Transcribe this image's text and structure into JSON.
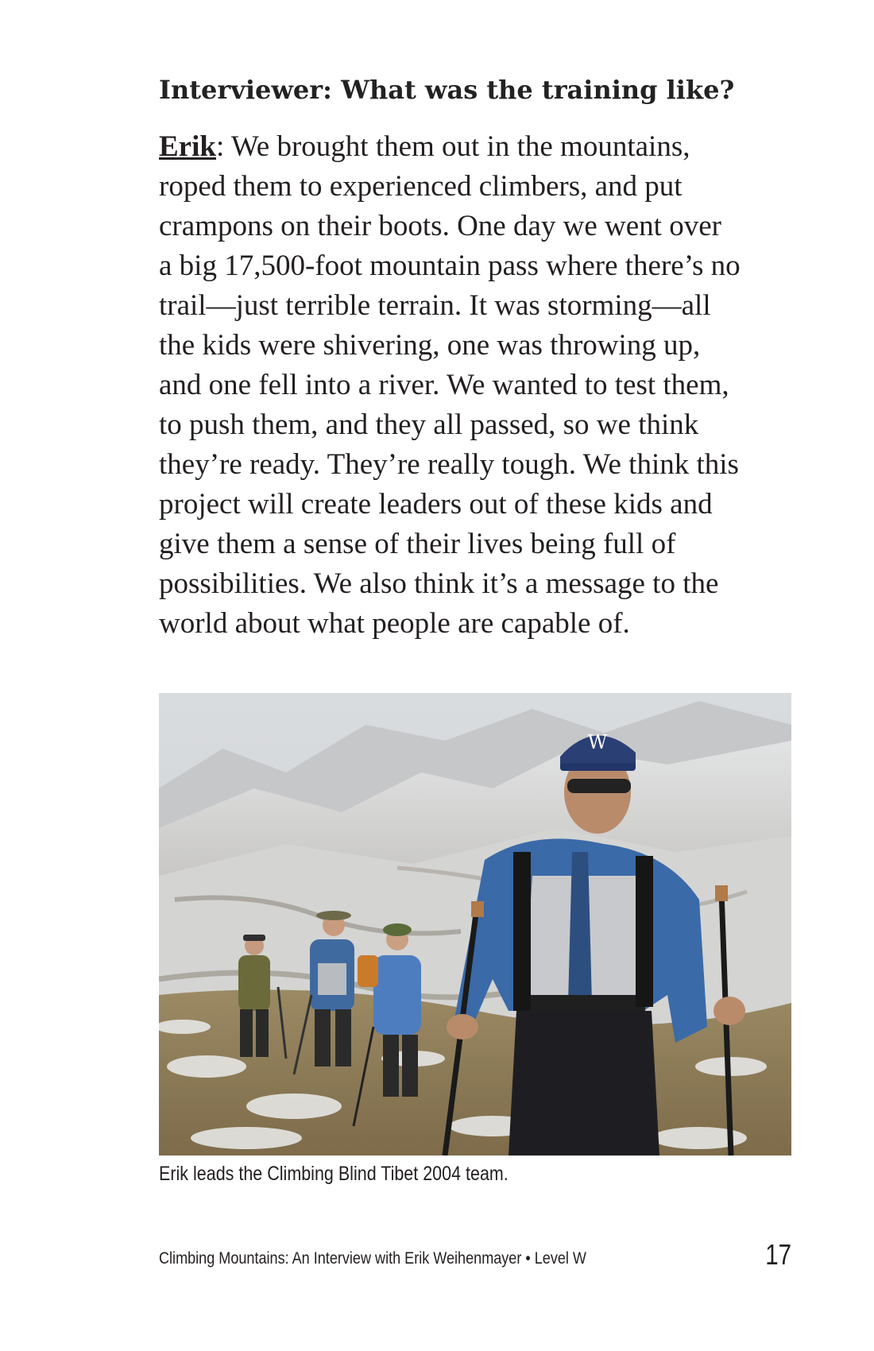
{
  "interview": {
    "question": "Interviewer: What was the training like?",
    "speaker": "Erik",
    "answer_lines": [
      ": We brought them out in the mountains,",
      "roped them to experienced climbers, and put",
      "crampons on their boots. One day we went over",
      "a big 17,500-foot mountain pass where there’s no",
      "trail—just terrible terrain. It was storming—all",
      "the kids were shivering, one was throwing up,",
      "and one fell into a river. We wanted to test them,",
      "to push them, and they all passed, so we think",
      "they’re ready. They’re really tough. We think this",
      "project will create leaders out of these kids and",
      "give them a sense of their lives being full of",
      "possibilities. We also think it’s a message to the",
      "world about what people are capable of."
    ]
  },
  "photo": {
    "cap_letter": "W",
    "caption": "Erik leads the Climbing Blind Tibet 2004 team."
  },
  "footer": {
    "title": "Climbing Mountains: An Interview with Erik Weihenmayer • Level W",
    "page_number": "17"
  }
}
